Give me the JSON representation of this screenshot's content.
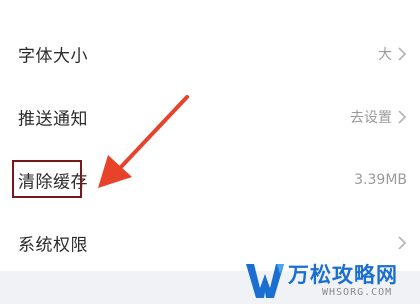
{
  "settings": {
    "items": [
      {
        "label": "字体大小",
        "value": "大"
      },
      {
        "label": "推送通知",
        "value": "去设置"
      },
      {
        "label": "清除缓存",
        "value": "3.39MB"
      },
      {
        "label": "系统权限",
        "value": ""
      }
    ]
  },
  "watermark": {
    "title": "万松攻略网",
    "url": "WHSORG.COM"
  },
  "colors": {
    "arrow": "#e8432a",
    "highlight_border": "#7a1717",
    "watermark_blue": "#1a6fd0"
  },
  "icons": {
    "chevron": "chevron-right-icon",
    "arrow": "red-arrow-annotation",
    "logo": "w-logo-icon"
  }
}
